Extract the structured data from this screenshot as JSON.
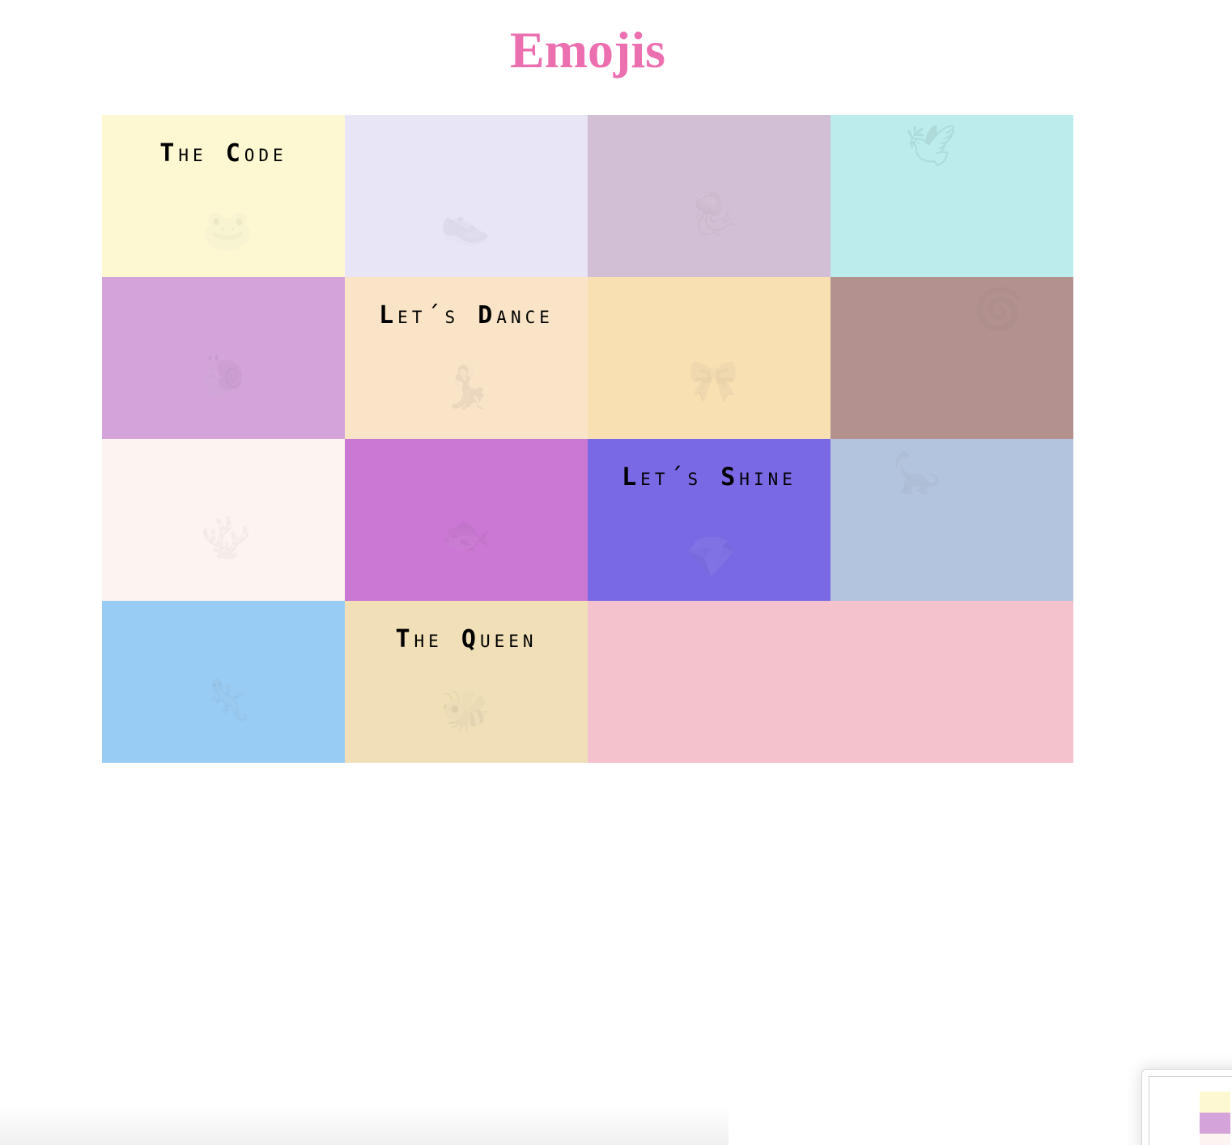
{
  "page": {
    "title": "Emojis"
  },
  "colors": {
    "title": "#ec6fb0"
  },
  "cells": [
    {
      "id": 1,
      "title_cap": "T",
      "title_rest": "HE ",
      "title_cap2": "C",
      "title_rest2": "ODE",
      "emoji_name": "frog-icon",
      "emoji": "🐸",
      "color": "#fdf8d2"
    },
    {
      "id": 2,
      "emoji_name": "shoe-icon",
      "emoji": "👟",
      "color": "#e7e5f6"
    },
    {
      "id": 3,
      "emoji_name": "jellyfish-icon",
      "emoji": "🪼",
      "color": "#d3bfd5"
    },
    {
      "id": 4,
      "emoji_name": "bird-icon",
      "emoji": "🕊",
      "color": "#bcecec"
    },
    {
      "id": 5,
      "emoji_name": "snail-icon",
      "emoji": "🐌",
      "color": "#d4a3da"
    },
    {
      "id": 6,
      "title_cap": "L",
      "title_rest": "ET´S ",
      "title_cap2": "D",
      "title_rest2": "ANCE",
      "emoji_name": "dancer-icon",
      "emoji": "💃",
      "color": "#f9e4c8"
    },
    {
      "id": 7,
      "emoji_name": "bow-icon",
      "emoji": "🎀",
      "color": "#f9e0b3"
    },
    {
      "id": 8,
      "emoji_name": "swirl-icon",
      "emoji": "🌀",
      "color": "#b3918e"
    },
    {
      "id": 9,
      "emoji_name": "coral-icon",
      "emoji": "🪸",
      "color": "#fcf4f0"
    },
    {
      "id": 10,
      "emoji_name": "fish-icon",
      "emoji": "🐟",
      "color": "#cb77d4"
    },
    {
      "id": 11,
      "title_cap": "L",
      "title_rest": "ET´S ",
      "title_cap2": "S",
      "title_rest2": "HINE",
      "emoji_name": "gem-icon",
      "emoji": "💎",
      "color": "#7969e5"
    },
    {
      "id": 12,
      "emoji_name": "dinosaur-icon",
      "emoji": "🦕",
      "color": "#b3c4de"
    },
    {
      "id": 13,
      "emoji_name": "lizard-icon",
      "emoji": "🦎",
      "color": "#99ccf5"
    },
    {
      "id": 14,
      "title_cap": "T",
      "title_rest": "HE ",
      "title_cap2": "Q",
      "title_rest2": "UEEN",
      "emoji_name": "bee-icon",
      "emoji": "🐝",
      "color": "#f0dfb7"
    },
    {
      "id": 15,
      "emoji_name": "",
      "emoji": "",
      "color": "#f4c2cc"
    }
  ]
}
